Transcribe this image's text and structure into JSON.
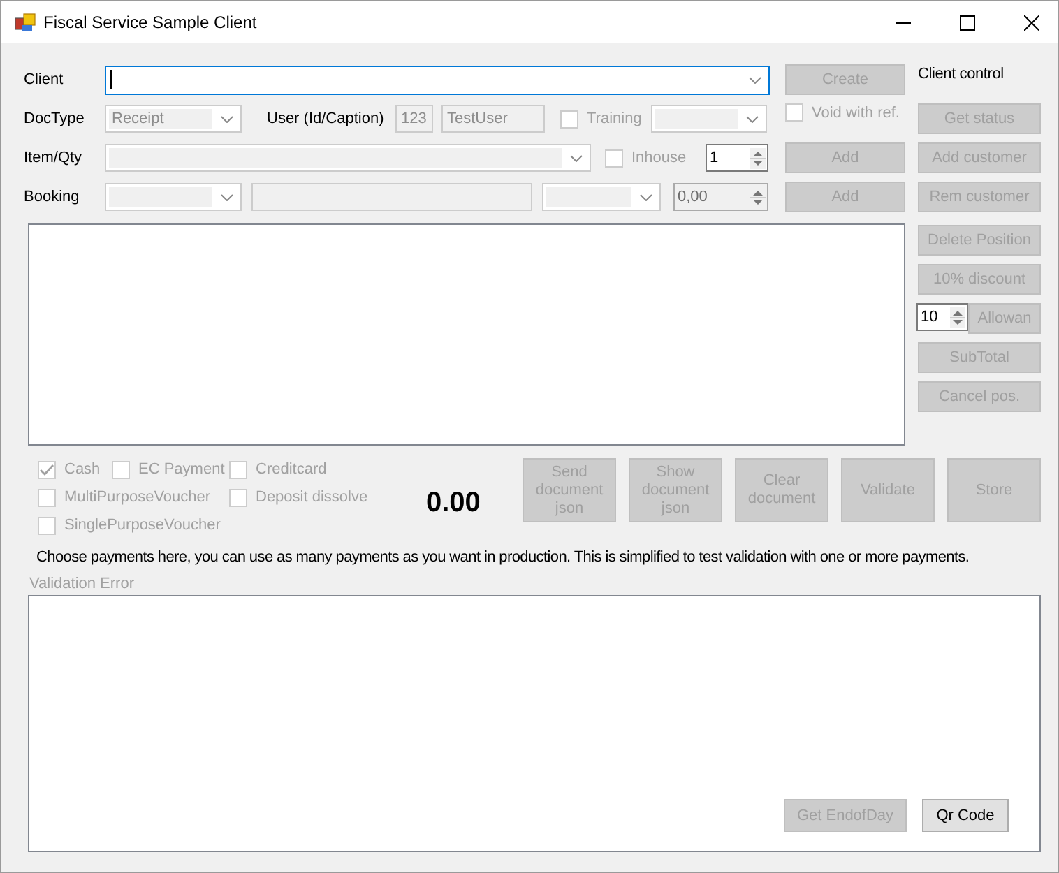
{
  "window": {
    "title": "Fiscal Service Sample Client"
  },
  "client": {
    "label": "Client",
    "focused": true
  },
  "create_button": {
    "label": "Create",
    "disabled": true
  },
  "client_control": {
    "label": "Client control"
  },
  "doctype": {
    "label": "DocType",
    "value": "Receipt",
    "disabled": true
  },
  "user": {
    "label": "User (Id/Caption)",
    "id": "123",
    "caption": "TestUser"
  },
  "training": {
    "label": "Training",
    "checked": false,
    "disabled": true
  },
  "void_with_ref": {
    "label": "Void with ref.",
    "checked": false,
    "disabled": true
  },
  "item": {
    "label": "Item/Qty",
    "inhouse": {
      "label": "Inhouse",
      "checked": false,
      "disabled": true
    },
    "quantity": "1",
    "add_button": {
      "label": "Add",
      "disabled": true
    }
  },
  "booking": {
    "label": "Booking",
    "amount": "0,00",
    "add_button": {
      "label": "Add",
      "disabled": true
    }
  },
  "side_buttons": [
    {
      "kind": "button",
      "label": "Get status",
      "disabled": true
    },
    {
      "kind": "button",
      "label": "Add customer",
      "disabled": true
    },
    {
      "kind": "button",
      "label": "Rem customer",
      "disabled": true
    },
    {
      "kind": "button",
      "label": "Delete Position",
      "disabled": true
    },
    {
      "kind": "button",
      "label": "10% discount",
      "disabled": true
    },
    {
      "kind": "spinner_button",
      "value": "10",
      "label": "Allowan",
      "disabled": true
    },
    {
      "kind": "button",
      "label": "SubTotal",
      "disabled": true
    },
    {
      "kind": "button",
      "label": "Cancel pos.",
      "disabled": true
    }
  ],
  "payments": [
    [
      {
        "label": "Cash",
        "checked": true,
        "disabled": true
      },
      {
        "label": "EC Payment",
        "checked": false,
        "disabled": true
      },
      {
        "label": "Creditcard",
        "checked": false,
        "disabled": true
      }
    ],
    [
      {
        "label": "MultiPurposeVoucher",
        "checked": false,
        "disabled": true
      },
      {
        "label": "Deposit dissolve",
        "checked": false,
        "disabled": true
      }
    ],
    [
      {
        "label": "SinglePurposeVoucher",
        "checked": false,
        "disabled": true
      }
    ]
  ],
  "total": "0.00",
  "action_buttons": [
    {
      "label": "Send document json",
      "disabled": true
    },
    {
      "label": "Show document json",
      "disabled": true
    },
    {
      "label": "Clear document",
      "disabled": true
    },
    {
      "label": "Validate",
      "disabled": true
    },
    {
      "label": "Store",
      "disabled": true
    }
  ],
  "hint": "Choose payments here, you can use as many payments as you want in production. This is simplified to test validation with one or more payments.",
  "validation": {
    "label": "Validation Error"
  },
  "bottom_buttons": [
    {
      "label": "Get EndofDay",
      "disabled": true
    },
    {
      "label": "Qr Code",
      "disabled": false
    }
  ]
}
